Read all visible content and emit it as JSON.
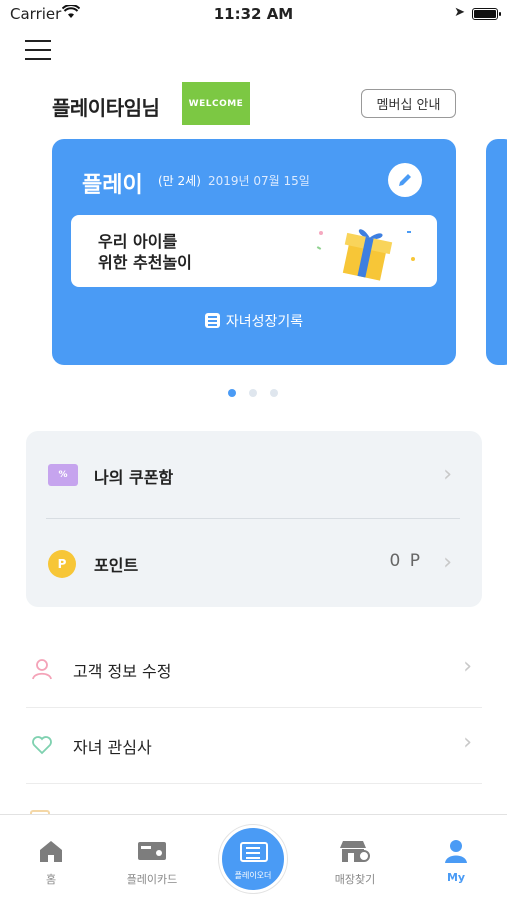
{
  "status": {
    "carrier": "Carrier",
    "time": "11:32 AM"
  },
  "header": {
    "username": "플레이타임님",
    "welcome_badge": "WELCOME",
    "membership_button": "멤버십 안내"
  },
  "child_card": {
    "name": "플레이",
    "age": "(만 2세)",
    "birthday": "2019년 07월 15일",
    "recommend_line1": "우리 아이를",
    "recommend_line2": "위한 추천놀이",
    "growth_record": "자녀성장기록"
  },
  "carousel": {
    "page_count": 3,
    "active_index": 0
  },
  "benefits": {
    "coupon_label": "나의 쿠폰함",
    "coupon_icon_text": "%",
    "point_label": "포인트",
    "point_icon_text": "P",
    "point_value": "0 P"
  },
  "menu_list": [
    {
      "label": "고객 정보 수정",
      "icon": "person-icon"
    },
    {
      "label": "자녀 관심사",
      "icon": "heart-icon"
    }
  ],
  "tabbar": {
    "tabs": [
      {
        "label": "홈",
        "icon": "home-icon"
      },
      {
        "label": "플레이카드",
        "icon": "card-icon"
      },
      {
        "label": "플레이오더",
        "icon": "ticket-icon"
      },
      {
        "label": "매장찾기",
        "icon": "store-icon"
      },
      {
        "label": "My",
        "icon": "user-icon"
      }
    ],
    "active": "My"
  },
  "colors": {
    "accent": "#4a9bf5",
    "welcome": "#7cc843",
    "coupon": "#c6a4ee",
    "point": "#f7c637",
    "panel": "#f0f3f6"
  }
}
